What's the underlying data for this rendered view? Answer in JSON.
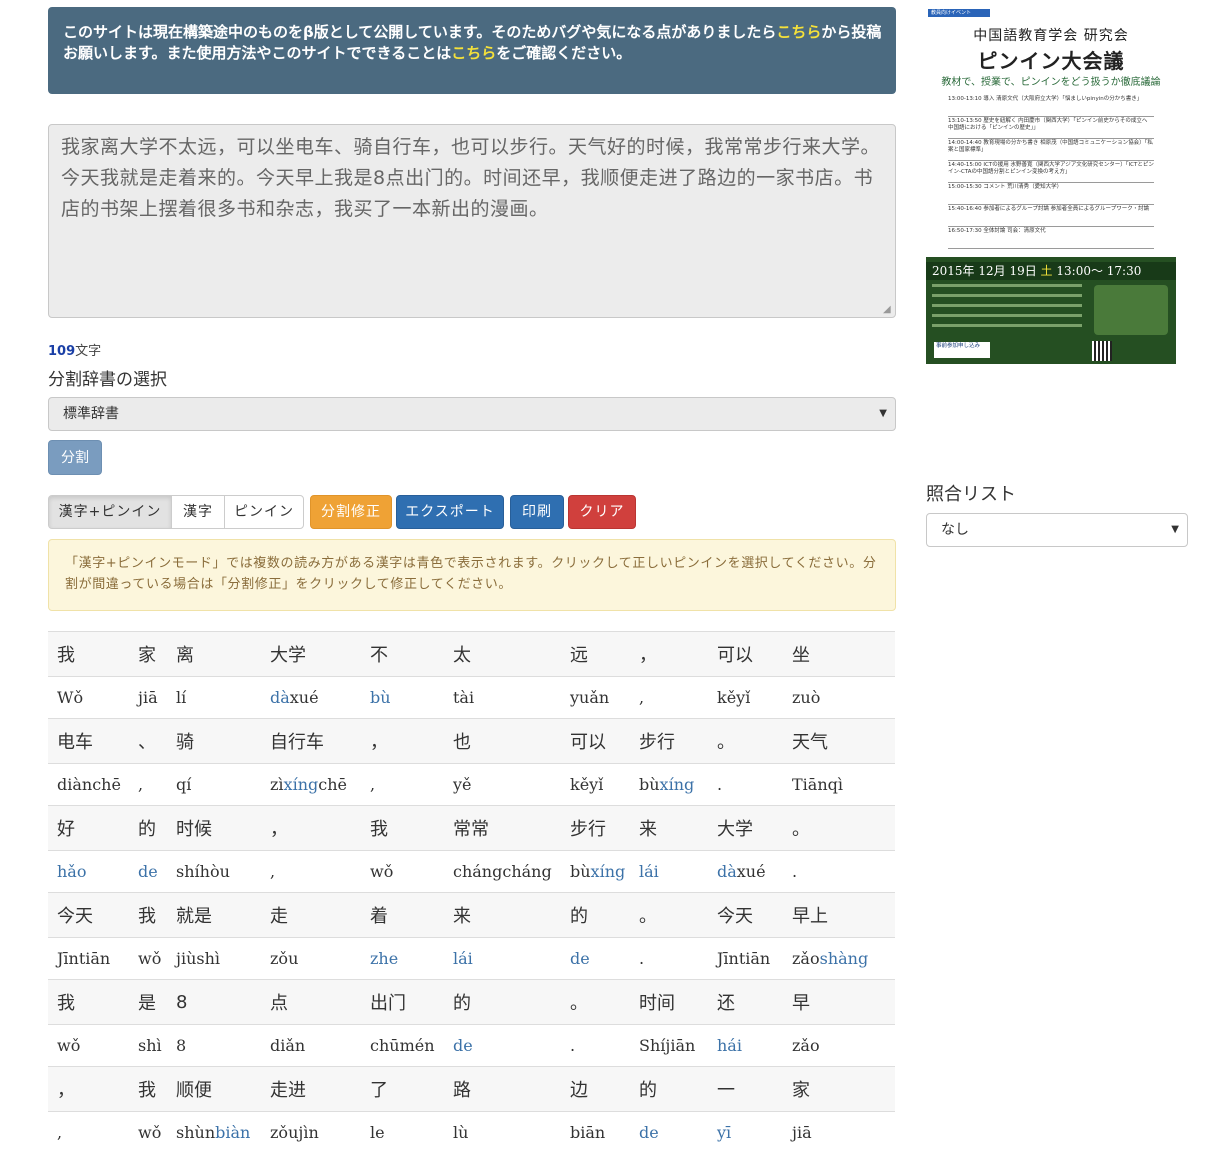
{
  "notice": {
    "part1": "このサイトは現在構築途中のものをβ版として公開しています。そのためバグや気になる点がありましたら",
    "link1": "こちら",
    "part2": "から投稿お願いします。また使用方法やこのサイトでできることは",
    "link2": "こちら",
    "part3": "をご確認ください。"
  },
  "input": {
    "text": "我家离大学不太远，可以坐电车、骑自行车，也可以步行。天气好的时候，我常常步行来大学。今天我就是走着来的。今天早上我是8点出门的。时间还早，我顺便走进了路边的一家书店。书店的书架上摆着很多书和杂志，我买了一本新出的漫画。"
  },
  "char_count": {
    "value": "109",
    "unit": "文字"
  },
  "dictionary": {
    "label": "分割辞書の選択",
    "selected": "標準辞書"
  },
  "split_button": "分割",
  "toolbar": {
    "mode_kanji_pinyin": "漢字+ピンイン",
    "mode_kanji": "漢字",
    "mode_pinyin": "ピンイン",
    "fix": "分割修正",
    "export": "エクスポート",
    "print": "印刷",
    "clear": "クリア"
  },
  "warning": "「漢字+ピンインモード」では複数の読み方がある漢字は青色で表示されます。クリックして正しいピンインを選択してください。分割が間違っている場合は「分割修正」をクリックして修正してください。",
  "segments": [
    [
      {
        "h": "我",
        "p": [
          [
            "Wǒ",
            0
          ]
        ]
      },
      {
        "h": "家",
        "p": [
          [
            "jiā",
            0
          ]
        ]
      },
      {
        "h": "离",
        "p": [
          [
            "lí",
            0
          ]
        ]
      },
      {
        "h": "大学",
        "p": [
          [
            "dà",
            1
          ],
          [
            "xué",
            0
          ]
        ]
      },
      {
        "h": "不",
        "p": [
          [
            "bù",
            1
          ]
        ]
      },
      {
        "h": "太",
        "p": [
          [
            "tài",
            0
          ]
        ]
      },
      {
        "h": "远",
        "p": [
          [
            "yuǎn",
            0
          ]
        ]
      },
      {
        "h": "，",
        "p": [
          [
            ",",
            0
          ]
        ]
      },
      {
        "h": "可以",
        "p": [
          [
            "kěyǐ",
            0
          ]
        ]
      },
      {
        "h": "坐",
        "p": [
          [
            "zuò",
            0
          ]
        ]
      }
    ],
    [
      {
        "h": "电车",
        "p": [
          [
            "diànchē",
            0
          ]
        ]
      },
      {
        "h": "、",
        "p": [
          [
            ",",
            0
          ]
        ]
      },
      {
        "h": "骑",
        "p": [
          [
            "qí",
            0
          ]
        ]
      },
      {
        "h": "自行车",
        "p": [
          [
            "zì",
            0
          ],
          [
            "xíng",
            1
          ],
          [
            "chē",
            0
          ]
        ]
      },
      {
        "h": "，",
        "p": [
          [
            ",",
            0
          ]
        ]
      },
      {
        "h": "也",
        "p": [
          [
            "yě",
            0
          ]
        ]
      },
      {
        "h": "可以",
        "p": [
          [
            "kěyǐ",
            0
          ]
        ]
      },
      {
        "h": "步行",
        "p": [
          [
            "bù",
            0
          ],
          [
            "xíng",
            1
          ]
        ]
      },
      {
        "h": "。",
        "p": [
          [
            ".",
            0
          ]
        ]
      },
      {
        "h": "天气",
        "p": [
          [
            "Tiānqì",
            0
          ]
        ]
      }
    ],
    [
      {
        "h": "好",
        "p": [
          [
            "hǎo",
            1
          ]
        ]
      },
      {
        "h": "的",
        "p": [
          [
            "de",
            1
          ]
        ]
      },
      {
        "h": "时候",
        "p": [
          [
            "shíhòu",
            0
          ]
        ]
      },
      {
        "h": "，",
        "p": [
          [
            ",",
            0
          ]
        ]
      },
      {
        "h": "我",
        "p": [
          [
            "wǒ",
            0
          ]
        ]
      },
      {
        "h": "常常",
        "p": [
          [
            "chángcháng",
            0
          ]
        ]
      },
      {
        "h": "步行",
        "p": [
          [
            "bù",
            0
          ],
          [
            "xíng",
            1
          ]
        ]
      },
      {
        "h": "来",
        "p": [
          [
            "lái",
            1
          ]
        ]
      },
      {
        "h": "大学",
        "p": [
          [
            "dà",
            1
          ],
          [
            "xué",
            0
          ]
        ]
      },
      {
        "h": "。",
        "p": [
          [
            ".",
            0
          ]
        ]
      }
    ],
    [
      {
        "h": "今天",
        "p": [
          [
            "Jīntiān",
            0
          ]
        ]
      },
      {
        "h": "我",
        "p": [
          [
            "wǒ",
            0
          ]
        ]
      },
      {
        "h": "就是",
        "p": [
          [
            "jiùshì",
            0
          ]
        ]
      },
      {
        "h": "走",
        "p": [
          [
            "zǒu",
            0
          ]
        ]
      },
      {
        "h": "着",
        "p": [
          [
            "zhe",
            1
          ]
        ]
      },
      {
        "h": "来",
        "p": [
          [
            "lái",
            1
          ]
        ]
      },
      {
        "h": "的",
        "p": [
          [
            "de",
            1
          ]
        ]
      },
      {
        "h": "。",
        "p": [
          [
            ".",
            0
          ]
        ]
      },
      {
        "h": "今天",
        "p": [
          [
            "Jīntiān",
            0
          ]
        ]
      },
      {
        "h": "早上",
        "p": [
          [
            "zǎo",
            0
          ],
          [
            "shàng",
            1
          ]
        ]
      }
    ],
    [
      {
        "h": "我",
        "p": [
          [
            "wǒ",
            0
          ]
        ]
      },
      {
        "h": "是",
        "p": [
          [
            "shì",
            0
          ]
        ]
      },
      {
        "h": "8",
        "p": [
          [
            "8",
            0
          ]
        ]
      },
      {
        "h": "点",
        "p": [
          [
            "diǎn",
            0
          ]
        ]
      },
      {
        "h": "出门",
        "p": [
          [
            "chūmén",
            0
          ]
        ]
      },
      {
        "h": "的",
        "p": [
          [
            "de",
            1
          ]
        ]
      },
      {
        "h": "。",
        "p": [
          [
            ".",
            0
          ]
        ]
      },
      {
        "h": "时间",
        "p": [
          [
            "Shíjiān",
            0
          ]
        ]
      },
      {
        "h": "还",
        "p": [
          [
            "hái",
            1
          ]
        ]
      },
      {
        "h": "早",
        "p": [
          [
            "zǎo",
            0
          ]
        ]
      }
    ],
    [
      {
        "h": "，",
        "p": [
          [
            ",",
            0
          ]
        ]
      },
      {
        "h": "我",
        "p": [
          [
            "wǒ",
            0
          ]
        ]
      },
      {
        "h": "顺便",
        "p": [
          [
            "shùn",
            0
          ],
          [
            "biàn",
            1
          ]
        ]
      },
      {
        "h": "走进",
        "p": [
          [
            "zǒujìn",
            0
          ]
        ]
      },
      {
        "h": "了",
        "p": [
          [
            "le",
            0
          ]
        ]
      },
      {
        "h": "路",
        "p": [
          [
            "lù",
            0
          ]
        ]
      },
      {
        "h": "边",
        "p": [
          [
            "biān",
            0
          ]
        ]
      },
      {
        "h": "的",
        "p": [
          [
            "de",
            1
          ]
        ]
      },
      {
        "h": "一",
        "p": [
          [
            "yī",
            1
          ]
        ]
      },
      {
        "h": "家",
        "p": [
          [
            "jiā",
            0
          ]
        ]
      }
    ]
  ],
  "colors": {
    "ambiguous_pinyin": "#3c72a8",
    "notice_bg": "#4b6a80",
    "notice_link": "#f5e13a"
  },
  "ad": {
    "tag": "教員向けイベント",
    "org": "中国語教育学会 研究会",
    "title": "ピンイン大会議",
    "subtitle": "教材で、授業で、ピンインをどう扱うか徹底議論",
    "schedule": [
      "13:00-13:10 導入 清原文代（大阪府立大学）「悩ましいpinyinの分かち書き」",
      "13:10-13:50 歴史を紐解く 内田慶市（関西大学）「ピンイン前史からその成立へ 中国語における「ピンインの歴史」」",
      "14:00-14:40 教育現場の分かち書き 相原茂（中国語コミュニケーション協会）「私案と国家標準」",
      "14:40-15:00 ICTの援用 氷野善寛（関西大学アジア文化研究センター）「ICTとピンイン-CTAの中国語分割とピンイン変換の考え方」",
      "15:00-15:30 コメント 荒川清秀（愛知大学）",
      "15:40-16:40 参加者によるグループ討論 参加者全員によるグループワーク・討論",
      "16:50-17:30 全体討論 司会：清原文代"
    ],
    "date": "2015年 12月 19日",
    "weekday": "土",
    "time": "13:00～ 17:30",
    "apply": "事前参加申し込み"
  },
  "match_list": {
    "label": "照合リスト",
    "selected": "なし"
  }
}
